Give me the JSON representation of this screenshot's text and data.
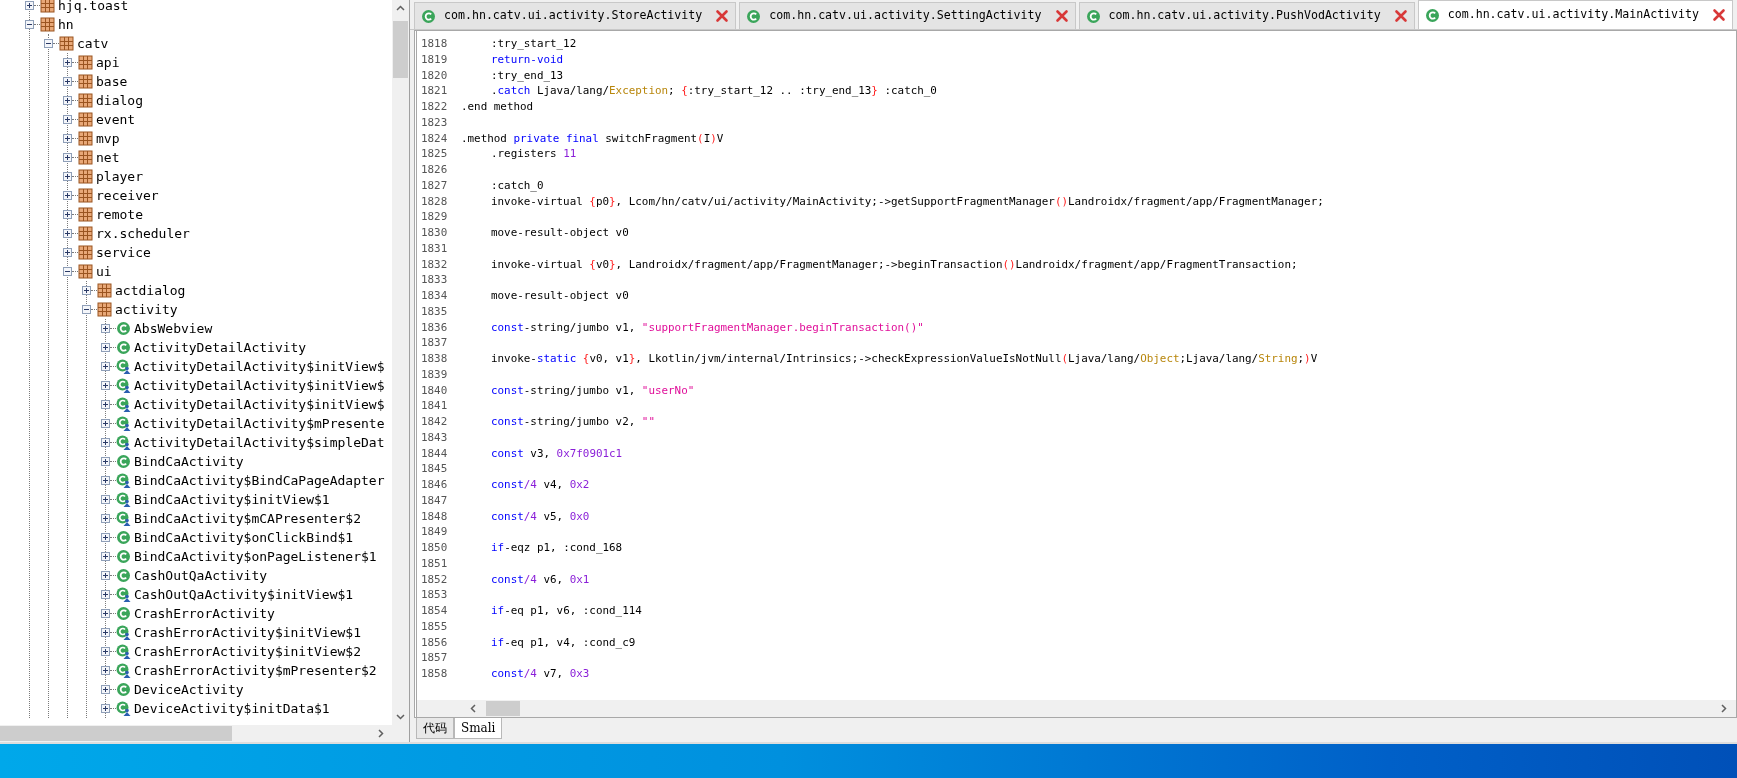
{
  "tree": {
    "items": [
      {
        "label": "hjq.toast",
        "kind": "package",
        "expanded": false
      },
      {
        "label": "hn",
        "kind": "package",
        "expanded": true,
        "children": [
          {
            "label": "catv",
            "kind": "package",
            "expanded": true,
            "children": [
              {
                "label": "api",
                "kind": "package",
                "expanded": false
              },
              {
                "label": "base",
                "kind": "package",
                "expanded": false
              },
              {
                "label": "dialog",
                "kind": "package",
                "expanded": false
              },
              {
                "label": "event",
                "kind": "package",
                "expanded": false
              },
              {
                "label": "mvp",
                "kind": "package",
                "expanded": false
              },
              {
                "label": "net",
                "kind": "package",
                "expanded": false
              },
              {
                "label": "player",
                "kind": "package",
                "expanded": false
              },
              {
                "label": "receiver",
                "kind": "package",
                "expanded": false
              },
              {
                "label": "remote",
                "kind": "package",
                "expanded": false
              },
              {
                "label": "rx.scheduler",
                "kind": "package",
                "expanded": false
              },
              {
                "label": "service",
                "kind": "package",
                "expanded": false
              },
              {
                "label": "ui",
                "kind": "package",
                "expanded": true,
                "children": [
                  {
                    "label": "actdialog",
                    "kind": "package",
                    "expanded": false
                  },
                  {
                    "label": "activity",
                    "kind": "package",
                    "expanded": true,
                    "children": [
                      {
                        "label": "AbsWebview",
                        "kind": "class",
                        "expanded": false
                      },
                      {
                        "label": "ActivityDetailActivity",
                        "kind": "class",
                        "expanded": false
                      },
                      {
                        "label": "ActivityDetailActivity$initView$",
                        "kind": "inner_class",
                        "expanded": false
                      },
                      {
                        "label": "ActivityDetailActivity$initView$",
                        "kind": "inner_class",
                        "expanded": false
                      },
                      {
                        "label": "ActivityDetailActivity$initView$",
                        "kind": "inner_class",
                        "expanded": false
                      },
                      {
                        "label": "ActivityDetailActivity$mPresente",
                        "kind": "inner_class",
                        "expanded": false
                      },
                      {
                        "label": "ActivityDetailActivity$simpleDat",
                        "kind": "inner_class",
                        "expanded": false
                      },
                      {
                        "label": "BindCaActivity",
                        "kind": "class",
                        "expanded": false
                      },
                      {
                        "label": "BindCaActivity$BindCaPageAdapter",
                        "kind": "inner_class",
                        "expanded": false
                      },
                      {
                        "label": "BindCaActivity$initView$1",
                        "kind": "inner_class",
                        "expanded": false
                      },
                      {
                        "label": "BindCaActivity$mCAPresenter$2",
                        "kind": "inner_class",
                        "expanded": false
                      },
                      {
                        "label": "BindCaActivity$onClickBind$1",
                        "kind": "class",
                        "expanded": false
                      },
                      {
                        "label": "BindCaActivity$onPageListener$1",
                        "kind": "class",
                        "expanded": false
                      },
                      {
                        "label": "CashOutQaActivity",
                        "kind": "class",
                        "expanded": false
                      },
                      {
                        "label": "CashOutQaActivity$initView$1",
                        "kind": "inner_class",
                        "expanded": false
                      },
                      {
                        "label": "CrashErrorActivity",
                        "kind": "class",
                        "expanded": false
                      },
                      {
                        "label": "CrashErrorActivity$initView$1",
                        "kind": "inner_class",
                        "expanded": false
                      },
                      {
                        "label": "CrashErrorActivity$initView$2",
                        "kind": "inner_class",
                        "expanded": false
                      },
                      {
                        "label": "CrashErrorActivity$mPresenter$2",
                        "kind": "inner_class",
                        "expanded": false
                      },
                      {
                        "label": "DeviceActivity",
                        "kind": "class",
                        "expanded": false
                      },
                      {
                        "label": "DeviceActivity$initData$1",
                        "kind": "inner_class",
                        "expanded": false
                      }
                    ]
                  }
                ]
              }
            ]
          }
        ]
      }
    ]
  },
  "editor": {
    "tabs": [
      {
        "label": "com.hn.catv.ui.activity.StoreActivity",
        "selected": false
      },
      {
        "label": "com.hn.catv.ui.activity.SettingActivity",
        "selected": false
      },
      {
        "label": "com.hn.catv.ui.activity.PushVodActivity",
        "selected": false
      },
      {
        "label": "com.hn.catv.ui.activity.MainActivity",
        "selected": true
      }
    ],
    "lines": [
      {
        "number": "1818",
        "indent": true,
        "tokens": [
          {
            "kind": "plain",
            "text": ":try_start_12"
          }
        ]
      },
      {
        "number": "1819",
        "indent": true,
        "tokens": [
          {
            "kind": "keyword",
            "text": "return-void"
          }
        ]
      },
      {
        "number": "1820",
        "indent": true,
        "tokens": [
          {
            "kind": "plain",
            "text": ":try_end_13"
          }
        ]
      },
      {
        "number": "1821",
        "indent": true,
        "tokens": [
          {
            "kind": "plain",
            "text": "."
          },
          {
            "kind": "keyword",
            "text": "catch"
          },
          {
            "kind": "plain",
            "text": " Ljava/lang/"
          },
          {
            "kind": "type",
            "text": "Exception"
          },
          {
            "kind": "plain",
            "text": "; "
          },
          {
            "kind": "brace",
            "text": "{"
          },
          {
            "kind": "plain",
            "text": ":try_start_12 .. :try_end_13"
          },
          {
            "kind": "brace",
            "text": "}"
          },
          {
            "kind": "plain",
            "text": " :catch_0"
          }
        ]
      },
      {
        "number": "1822",
        "indent": false,
        "tokens": [
          {
            "kind": "plain",
            "text": ".end method"
          }
        ]
      },
      {
        "number": "1823"
      },
      {
        "number": "1824",
        "indent": false,
        "tokens": [
          {
            "kind": "plain",
            "text": ".method "
          },
          {
            "kind": "keyword",
            "text": "private"
          },
          {
            "kind": "keyword",
            "text": " final"
          },
          {
            "kind": "plain",
            "text": " switchFragment"
          },
          {
            "kind": "brace",
            "text": "("
          },
          {
            "kind": "plain",
            "text": "I"
          },
          {
            "kind": "brace",
            "text": ")"
          },
          {
            "kind": "plain",
            "text": "V"
          }
        ]
      },
      {
        "number": "1825",
        "indent": true,
        "tokens": [
          {
            "kind": "plain",
            "text": ".registers "
          },
          {
            "kind": "number",
            "text": "11"
          }
        ]
      },
      {
        "number": "1826"
      },
      {
        "number": "1827",
        "indent": true,
        "tokens": [
          {
            "kind": "plain",
            "text": ":catch_0"
          }
        ]
      },
      {
        "number": "1828",
        "indent": true,
        "tokens": [
          {
            "kind": "plain",
            "text": "invoke-virtual "
          },
          {
            "kind": "brace",
            "text": "{"
          },
          {
            "kind": "plain",
            "text": "p0"
          },
          {
            "kind": "brace",
            "text": "}"
          },
          {
            "kind": "plain",
            "text": ", Lcom/hn/catv/ui/activity/MainActivity;->getSupportFragmentManager"
          },
          {
            "kind": "brace",
            "text": "()"
          },
          {
            "kind": "plain",
            "text": "Landroidx/fragment/app/FragmentManager;"
          }
        ]
      },
      {
        "number": "1829"
      },
      {
        "number": "1830",
        "indent": true,
        "tokens": [
          {
            "kind": "plain",
            "text": "move-result-object v0"
          }
        ]
      },
      {
        "number": "1831"
      },
      {
        "number": "1832",
        "indent": true,
        "tokens": [
          {
            "kind": "plain",
            "text": "invoke-virtual "
          },
          {
            "kind": "brace",
            "text": "{"
          },
          {
            "kind": "plain",
            "text": "v0"
          },
          {
            "kind": "brace",
            "text": "}"
          },
          {
            "kind": "plain",
            "text": ", Landroidx/fragment/app/FragmentManager;->beginTransaction"
          },
          {
            "kind": "brace",
            "text": "()"
          },
          {
            "kind": "plain",
            "text": "Landroidx/fragment/app/FragmentTransaction;"
          }
        ]
      },
      {
        "number": "1833"
      },
      {
        "number": "1834",
        "indent": true,
        "tokens": [
          {
            "kind": "plain",
            "text": "move-result-object v0"
          }
        ]
      },
      {
        "number": "1835"
      },
      {
        "number": "1836",
        "indent": true,
        "tokens": [
          {
            "kind": "keyword",
            "text": "const"
          },
          {
            "kind": "plain",
            "text": "-string/jumbo v1, "
          },
          {
            "kind": "string",
            "text": "\"supportFragmentManager.beginTransaction()\""
          }
        ]
      },
      {
        "number": "1837"
      },
      {
        "number": "1838",
        "indent": true,
        "tokens": [
          {
            "kind": "plain",
            "text": "invoke-"
          },
          {
            "kind": "keyword",
            "text": "static"
          },
          {
            "kind": "brace",
            "text": " {"
          },
          {
            "kind": "plain",
            "text": "v0, v1"
          },
          {
            "kind": "brace",
            "text": "}"
          },
          {
            "kind": "plain",
            "text": ", Lkotlin/jvm/internal/Intrinsics;->checkExpressionValueIsNotNull"
          },
          {
            "kind": "brace",
            "text": "("
          },
          {
            "kind": "plain",
            "text": "Ljava/lang/"
          },
          {
            "kind": "type",
            "text": "Object"
          },
          {
            "kind": "plain",
            "text": ";Ljava/lang/"
          },
          {
            "kind": "type",
            "text": "String"
          },
          {
            "kind": "plain",
            "text": ";"
          },
          {
            "kind": "brace",
            "text": ")"
          },
          {
            "kind": "plain",
            "text": "V"
          }
        ]
      },
      {
        "number": "1839"
      },
      {
        "number": "1840",
        "indent": true,
        "tokens": [
          {
            "kind": "keyword",
            "text": "const"
          },
          {
            "kind": "plain",
            "text": "-string/jumbo v1, "
          },
          {
            "kind": "string",
            "text": "\"userNo\""
          }
        ]
      },
      {
        "number": "1841"
      },
      {
        "number": "1842",
        "indent": true,
        "tokens": [
          {
            "kind": "keyword",
            "text": "const"
          },
          {
            "kind": "plain",
            "text": "-string/jumbo v2, "
          },
          {
            "kind": "string",
            "text": "\"\""
          }
        ]
      },
      {
        "number": "1843"
      },
      {
        "number": "1844",
        "indent": true,
        "tokens": [
          {
            "kind": "keyword",
            "text": "const"
          },
          {
            "kind": "plain",
            "text": " v3, "
          },
          {
            "kind": "number",
            "text": "0x7f0901c1"
          }
        ]
      },
      {
        "number": "1845"
      },
      {
        "number": "1846",
        "indent": true,
        "tokens": [
          {
            "kind": "keyword",
            "text": "const"
          },
          {
            "kind": "number",
            "text": "/4"
          },
          {
            "kind": "plain",
            "text": " v4, "
          },
          {
            "kind": "number",
            "text": "0x2"
          }
        ]
      },
      {
        "number": "1847"
      },
      {
        "number": "1848",
        "indent": true,
        "tokens": [
          {
            "kind": "keyword",
            "text": "const"
          },
          {
            "kind": "number",
            "text": "/4"
          },
          {
            "kind": "plain",
            "text": " v5, "
          },
          {
            "kind": "number",
            "text": "0x0"
          }
        ]
      },
      {
        "number": "1849"
      },
      {
        "number": "1850",
        "indent": true,
        "tokens": [
          {
            "kind": "keyword",
            "text": "if"
          },
          {
            "kind": "plain",
            "text": "-eqz p1, :cond_168"
          }
        ]
      },
      {
        "number": "1851"
      },
      {
        "number": "1852",
        "indent": true,
        "tokens": [
          {
            "kind": "keyword",
            "text": "const"
          },
          {
            "kind": "number",
            "text": "/4"
          },
          {
            "kind": "plain",
            "text": " v6, "
          },
          {
            "kind": "number",
            "text": "0x1"
          }
        ]
      },
      {
        "number": "1853"
      },
      {
        "number": "1854",
        "indent": true,
        "tokens": [
          {
            "kind": "keyword",
            "text": "if"
          },
          {
            "kind": "plain",
            "text": "-eq p1, v6, :cond_114"
          }
        ]
      },
      {
        "number": "1855"
      },
      {
        "number": "1856",
        "indent": true,
        "tokens": [
          {
            "kind": "keyword",
            "text": "if"
          },
          {
            "kind": "plain",
            "text": "-eq p1, v4, :cond_c9"
          }
        ]
      },
      {
        "number": "1857"
      },
      {
        "number": "1858",
        "indent": true,
        "tokens": [
          {
            "kind": "keyword",
            "text": "const"
          },
          {
            "kind": "number",
            "text": "/4"
          },
          {
            "kind": "plain",
            "text": " v7, "
          },
          {
            "kind": "number",
            "text": "0x3"
          }
        ]
      }
    ],
    "view_tabs": [
      {
        "label": "代码",
        "selected": false
      },
      {
        "label": "Smali",
        "selected": true
      }
    ]
  }
}
